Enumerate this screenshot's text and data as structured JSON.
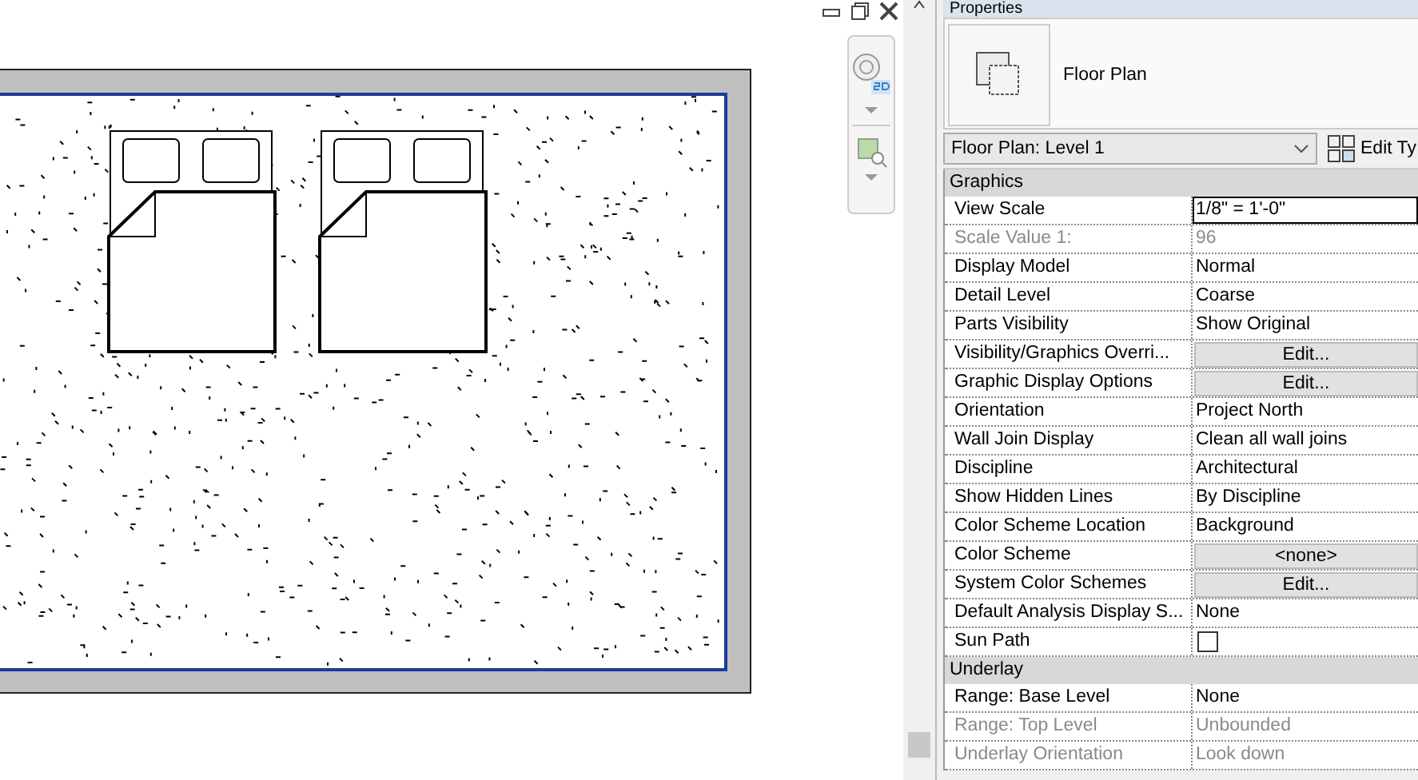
{
  "properties": {
    "title": "Properties",
    "type_name": "Floor Plan",
    "view_selector": "Floor Plan: Level 1",
    "edit_type_label": "Edit Ty",
    "groups": [
      {
        "name": "Graphics",
        "rows": [
          {
            "label": "View Scale",
            "kind": "text",
            "value": "1/8\" = 1'-0\"",
            "selected": true,
            "disabled": false
          },
          {
            "label": "Scale Value    1:",
            "kind": "text",
            "value": "96",
            "selected": false,
            "disabled": true
          },
          {
            "label": "Display Model",
            "kind": "text",
            "value": "Normal",
            "selected": false,
            "disabled": false
          },
          {
            "label": "Detail Level",
            "kind": "text",
            "value": "Coarse",
            "selected": false,
            "disabled": false
          },
          {
            "label": "Parts Visibility",
            "kind": "text",
            "value": "Show Original",
            "selected": false,
            "disabled": false
          },
          {
            "label": "Visibility/Graphics Overri...",
            "kind": "button",
            "value": "Edit...",
            "selected": false,
            "disabled": false
          },
          {
            "label": "Graphic Display Options",
            "kind": "button",
            "value": "Edit...",
            "selected": false,
            "disabled": false
          },
          {
            "label": "Orientation",
            "kind": "text",
            "value": "Project North",
            "selected": false,
            "disabled": false
          },
          {
            "label": "Wall Join Display",
            "kind": "text",
            "value": "Clean all wall joins",
            "selected": false,
            "disabled": false
          },
          {
            "label": "Discipline",
            "kind": "text",
            "value": "Architectural",
            "selected": false,
            "disabled": false
          },
          {
            "label": "Show Hidden Lines",
            "kind": "text",
            "value": "By Discipline",
            "selected": false,
            "disabled": false
          },
          {
            "label": "Color Scheme Location",
            "kind": "text",
            "value": "Background",
            "selected": false,
            "disabled": false
          },
          {
            "label": "Color Scheme",
            "kind": "button",
            "value": "<none>",
            "selected": false,
            "disabled": false
          },
          {
            "label": "System Color Schemes",
            "kind": "button",
            "value": "Edit...",
            "selected": false,
            "disabled": false
          },
          {
            "label": "Default Analysis Display S...",
            "kind": "text",
            "value": "None",
            "selected": false,
            "disabled": false
          },
          {
            "label": "Sun Path",
            "kind": "checkbox",
            "checked": false,
            "selected": false,
            "disabled": false
          }
        ]
      },
      {
        "name": "Underlay",
        "rows": [
          {
            "label": "Range: Base Level",
            "kind": "text",
            "value": "None",
            "selected": false,
            "disabled": false
          },
          {
            "label": "Range: Top Level",
            "kind": "text",
            "value": "Unbounded",
            "selected": false,
            "disabled": true
          },
          {
            "label": "Underlay Orientation",
            "kind": "text",
            "value": "Look down",
            "selected": false,
            "disabled": true
          }
        ]
      }
    ]
  }
}
